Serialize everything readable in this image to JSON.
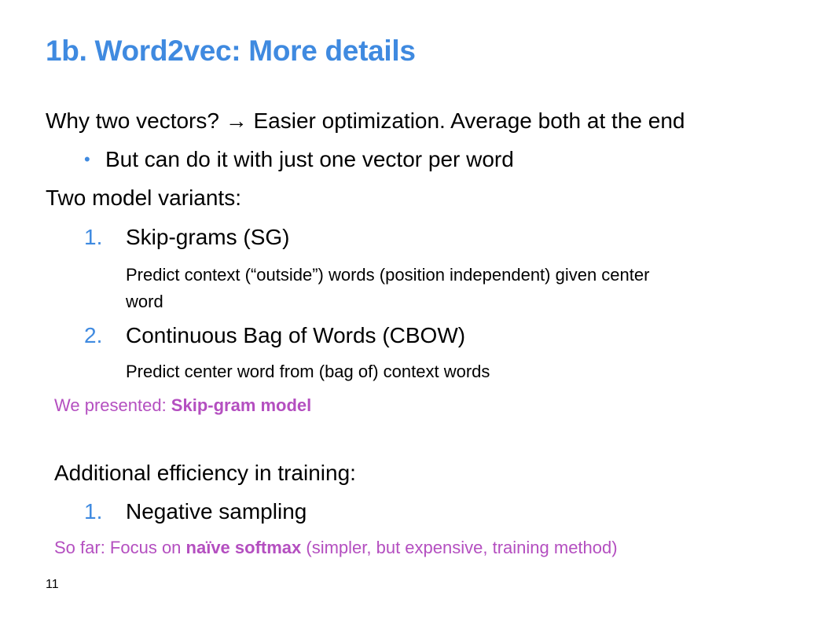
{
  "slide": {
    "title": "1b. Word2vec: More details",
    "line1": "Why two vectors? → Easier optimization. Average both at the end",
    "bullet_marker": "•",
    "bullet1": "But can do it with just one vector per word",
    "variants_heading": "Two model variants:",
    "variant1_num": "1.",
    "variant1_label": "Skip-grams (SG)",
    "variant1_desc_line1": "Predict context (“outside”) words (position independent) given center",
    "variant1_desc_line2": "word",
    "variant2_num": "2.",
    "variant2_label": "Continuous Bag of Words (CBOW)",
    "variant2_desc": "Predict center word from (bag of) context words",
    "note1_prefix": "We presented: ",
    "note1_bold": "Skip-gram model",
    "efficiency_heading": "Additional efficiency in training:",
    "eff1_num": "1.",
    "eff1_label": "Negative sampling",
    "note2_prefix": "So far: Focus on ",
    "note2_bold": "naïve softmax",
    "note2_suffix": " (simpler, but expensive, training method)",
    "page_number": "11"
  },
  "colors": {
    "title": "#3f8ae0",
    "numbering": "#3f8ae0",
    "note": "#b44fc0",
    "text": "#000000"
  }
}
